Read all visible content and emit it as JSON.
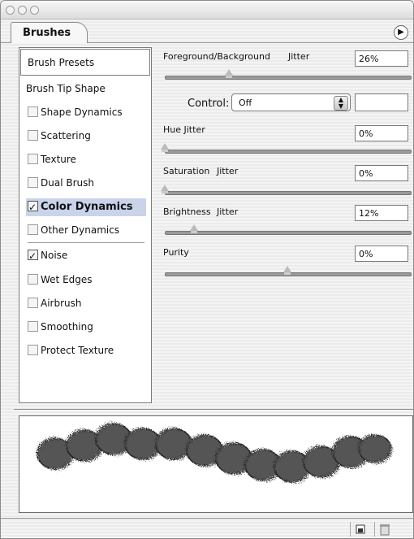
{
  "panel": {
    "tab_label": "Brushes"
  },
  "left": {
    "presets_label": "Brush Presets",
    "tip_shape_label": "Brush Tip Shape",
    "options": [
      {
        "label": "Shape Dynamics",
        "checked": false
      },
      {
        "label": "Scattering",
        "checked": false
      },
      {
        "label": "Texture",
        "checked": false
      },
      {
        "label": "Dual Brush",
        "checked": false
      },
      {
        "label": "Color Dynamics",
        "checked": true,
        "selected": true
      },
      {
        "label": "Other Dynamics",
        "checked": false
      }
    ],
    "extras": [
      {
        "label": "Noise",
        "checked": true
      },
      {
        "label": "Wet Edges",
        "checked": false
      },
      {
        "label": "Airbrush",
        "checked": false
      },
      {
        "label": "Smoothing",
        "checked": false
      },
      {
        "label": "Protect  Texture",
        "checked": false
      }
    ]
  },
  "right": {
    "fg_bg": {
      "label": "Foreground/Background",
      "jitter_label": "Jitter",
      "value": "26%",
      "level": 26
    },
    "control": {
      "label": "Control:",
      "value": "Off"
    },
    "hue": {
      "label": "Hue Jitter",
      "value": "0%",
      "level": 0
    },
    "saturation": {
      "label": "Saturation",
      "jitter_label": "Jitter",
      "value": "0%",
      "level": 0
    },
    "brightness": {
      "label": "Brightness",
      "jitter_label": "Jitter",
      "value": "12%",
      "level": 12
    },
    "purity": {
      "label": "Purity",
      "value": "0%",
      "level": 50
    }
  },
  "icons": {
    "panel_menu": "panel-menu-icon",
    "new_brush": "new-brush-icon",
    "delete": "trash-icon"
  }
}
